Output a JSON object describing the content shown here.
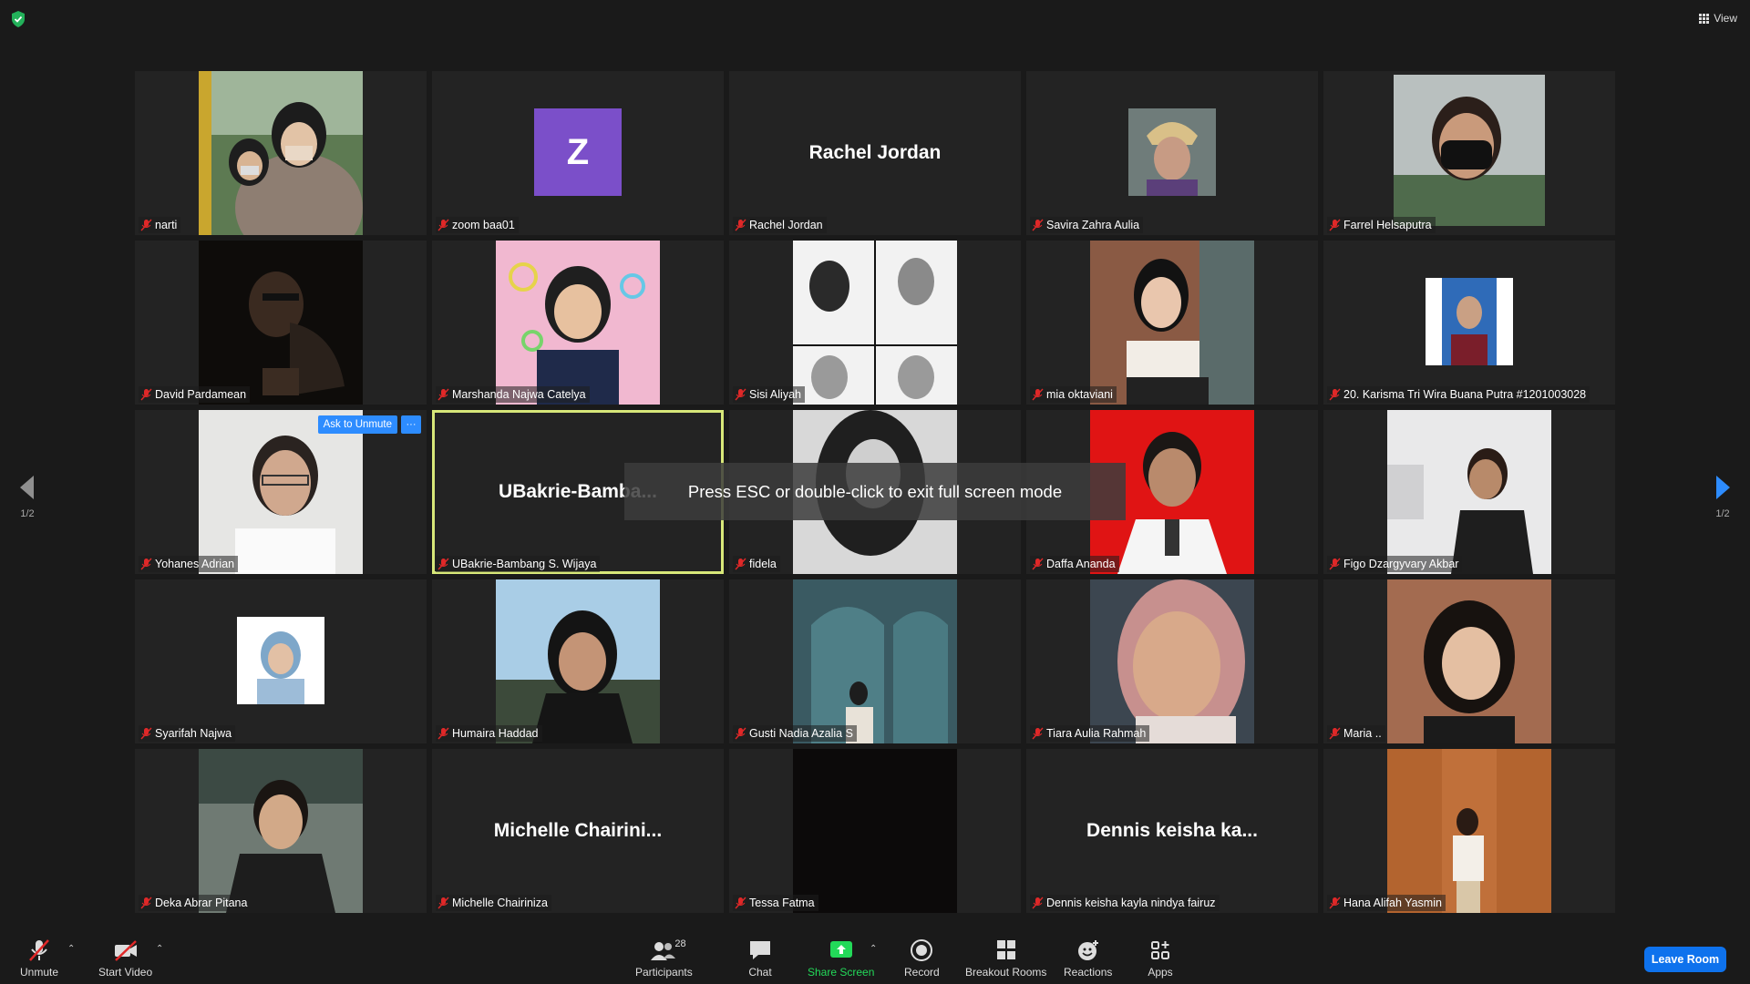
{
  "top": {
    "view_label": "View"
  },
  "tiles": [
    {
      "name": "narti"
    },
    {
      "name": "zoom baa01",
      "avatar_letter": "Z"
    },
    {
      "name": "Rachel Jordan",
      "big_name": "Rachel Jordan"
    },
    {
      "name": "Savira Zahra Aulia"
    },
    {
      "name": "Farrel Helsaputra"
    },
    {
      "name": "David Pardamean"
    },
    {
      "name": "Marshanda Najwa Catelya"
    },
    {
      "name": "Sisi Aliyah"
    },
    {
      "name": "mia oktaviani"
    },
    {
      "name": "20. Karisma Tri Wira Buana Putra #1201003028"
    },
    {
      "name": "Yohanes Adrian",
      "ask_label": "Ask to Unmute",
      "more_label": "···"
    },
    {
      "name": "UBakrie-Bambang S. Wijaya",
      "big_name": "UBakrie-Bamba..."
    },
    {
      "name": "fidela"
    },
    {
      "name": "Daffa Ananda"
    },
    {
      "name": "Figo Dzargyvary Akbar"
    },
    {
      "name": "Syarifah Najwa"
    },
    {
      "name": "Humaira Haddad"
    },
    {
      "name": "Gusti Nadia Azalia S"
    },
    {
      "name": "Tiara Aulia Rahmah"
    },
    {
      "name": "Maria .."
    },
    {
      "name": "Deka Abrar Pitana"
    },
    {
      "name": "Michelle Chairiniza",
      "big_name": "Michelle  Chairini..."
    },
    {
      "name": "Tessa Fatma"
    },
    {
      "name": "Dennis keisha kayla nindya fairuz",
      "big_name": "Dennis  keisha  ka..."
    },
    {
      "name": "Hana Alifah Yasmin"
    }
  ],
  "paging": {
    "prev": "1/2",
    "next": "1/2"
  },
  "toast": "Press ESC or double-click to exit full screen mode",
  "toolbar": {
    "unmute": "Unmute",
    "start_video": "Start Video",
    "participants": "Participants",
    "participants_count": "28",
    "chat": "Chat",
    "share_screen": "Share Screen",
    "record": "Record",
    "breakout": "Breakout Rooms",
    "reactions": "Reactions",
    "apps": "Apps",
    "leave": "Leave Room"
  },
  "colors": {
    "accent": "#0e72ed",
    "share_green": "#23d959",
    "active_border": "#d7e779",
    "muted_red": "#e02828"
  }
}
